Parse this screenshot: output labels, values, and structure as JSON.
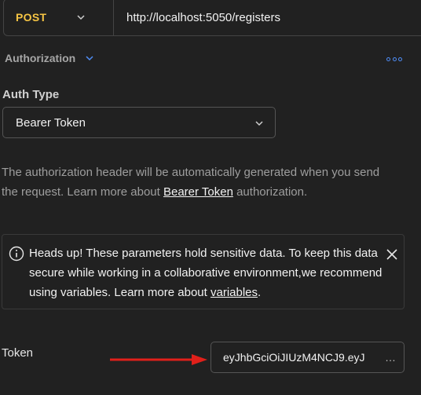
{
  "request": {
    "method": "POST",
    "url": "http://localhost:5050/registers"
  },
  "auth_tab": {
    "label": "Authorization"
  },
  "auth_type": {
    "label": "Auth Type",
    "selected": "Bearer Token"
  },
  "description": {
    "prefix": "The authorization header will be automatically generated when you send the request. Learn more about ",
    "link_text": "Bearer Token",
    "suffix": " authorization."
  },
  "banner": {
    "text_prefix": "Heads up! These parameters hold sensitive data. To keep this data secure while working in a collaborative environment,we recommend using variables. Learn more about ",
    "link_text": "variables",
    "text_suffix": "."
  },
  "token": {
    "label": "Token",
    "value": "eyJhbGciOiJIUzM4NCJ9.eyJ",
    "overflow": "…"
  },
  "colors": {
    "background": "#212121",
    "method": "#f6c544",
    "accent": "#4f8ef7",
    "arrow": "#e0201a"
  }
}
